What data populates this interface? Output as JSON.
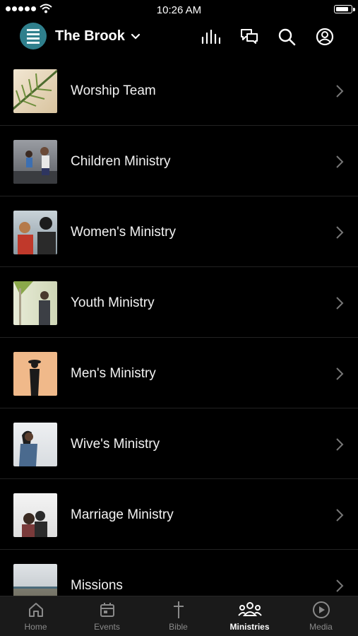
{
  "status": {
    "time": "10:26 AM"
  },
  "header": {
    "title": "The Brook"
  },
  "ministries": [
    {
      "label": "Worship Team"
    },
    {
      "label": "Children Ministry"
    },
    {
      "label": "Women's Ministry"
    },
    {
      "label": "Youth Ministry"
    },
    {
      "label": "Men's Ministry"
    },
    {
      "label": "Wive's Ministry"
    },
    {
      "label": "Marriage Ministry"
    },
    {
      "label": "Missions"
    }
  ],
  "tabs": [
    {
      "label": "Home",
      "icon": "home-icon"
    },
    {
      "label": "Events",
      "icon": "calendar-icon"
    },
    {
      "label": "Bible",
      "icon": "cross-icon"
    },
    {
      "label": "Ministries",
      "icon": "people-group-icon",
      "active": true
    },
    {
      "label": "Media",
      "icon": "play-circle-icon"
    }
  ],
  "colors": {
    "background": "#000000",
    "brand": "#2f7f8c",
    "tabbar": "#1a1a1a",
    "inactive": "#8a8a8a"
  }
}
